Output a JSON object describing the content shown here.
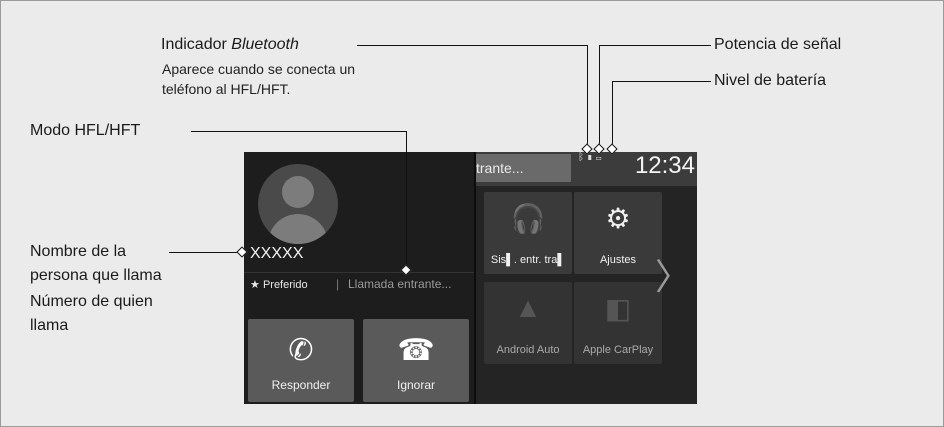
{
  "annotations": {
    "bluetooth_indicator_prefix": "Indicador ",
    "bluetooth_indicator_word": "Bluetooth",
    "bluetooth_note_line1": "Aparece cuando se conecta un",
    "bluetooth_note_line2": "teléfono al HFL/HFT.",
    "signal_strength": "Potencia de señal",
    "battery_level": "Nivel de batería",
    "hfl_mode": "Modo HFL/HFT",
    "caller_name_line1": "Nombre de la",
    "caller_name_line2": "persona que llama",
    "caller_number_line1": "Número de quien",
    "caller_number_line2": "llama"
  },
  "call": {
    "caller_name": "XXXXX",
    "favorite_label": "Preferido",
    "separator": "|",
    "status": "Llamada entrante...",
    "answer_label": "Responder",
    "ignore_label": "Ignorar"
  },
  "home": {
    "marquee_text": "trante...",
    "clock": "12:34",
    "tiles": [
      {
        "label": "Sis▌. entr. tra▌",
        "icon": "headphones-icon"
      },
      {
        "label": "Ajustes",
        "icon": "gear-icon"
      },
      {
        "label": "Android Auto",
        "icon": "android-auto-icon"
      },
      {
        "label": "Apple CarPlay",
        "icon": "apple-carplay-icon"
      }
    ]
  }
}
